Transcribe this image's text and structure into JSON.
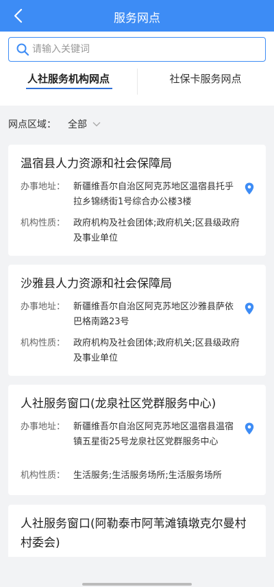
{
  "header": {
    "title": "服务网点"
  },
  "search": {
    "placeholder": "请输入关键词"
  },
  "tabs": [
    {
      "label": "人社服务机构网点",
      "active": true
    },
    {
      "label": "社保卡服务网点",
      "active": false
    }
  ],
  "filter": {
    "label": "网点区域：",
    "value": "全部"
  },
  "colors": {
    "primary": "#3d8cf5",
    "background": "#f2f3f5"
  },
  "cards": [
    {
      "title": "温宿县人力资源和社会保障局",
      "address_label": "办事地址：",
      "address": "新疆维吾尔自治区阿克苏地区温宿县托乎拉乡锦绣街1号综合办公楼3楼",
      "nature_label": "机构性质：",
      "nature": "政府机构及社会团体;政府机关;区县级政府及事业单位"
    },
    {
      "title": "沙雅县人力资源和社会保障局",
      "address_label": "办事地址：",
      "address": "新疆维吾尔自治区阿克苏地区沙雅县萨依巴格南路23号",
      "nature_label": "机构性质：",
      "nature": "政府机构及社会团体;政府机关;区县级政府及事业单位"
    },
    {
      "title": "人社服务窗口(龙泉社区党群服务中心)",
      "address_label": "办事地址：",
      "address": "新疆维吾尔自治区阿克苏地区温宿县温宿镇五星街25号龙泉社区党群服务中心",
      "nature_label": "机构性质：",
      "nature": "生活服务;生活服务场所;生活服务场所"
    },
    {
      "title": "人社服务窗口(阿勒泰市阿苇滩镇墩克尔曼村村委会)"
    }
  ]
}
